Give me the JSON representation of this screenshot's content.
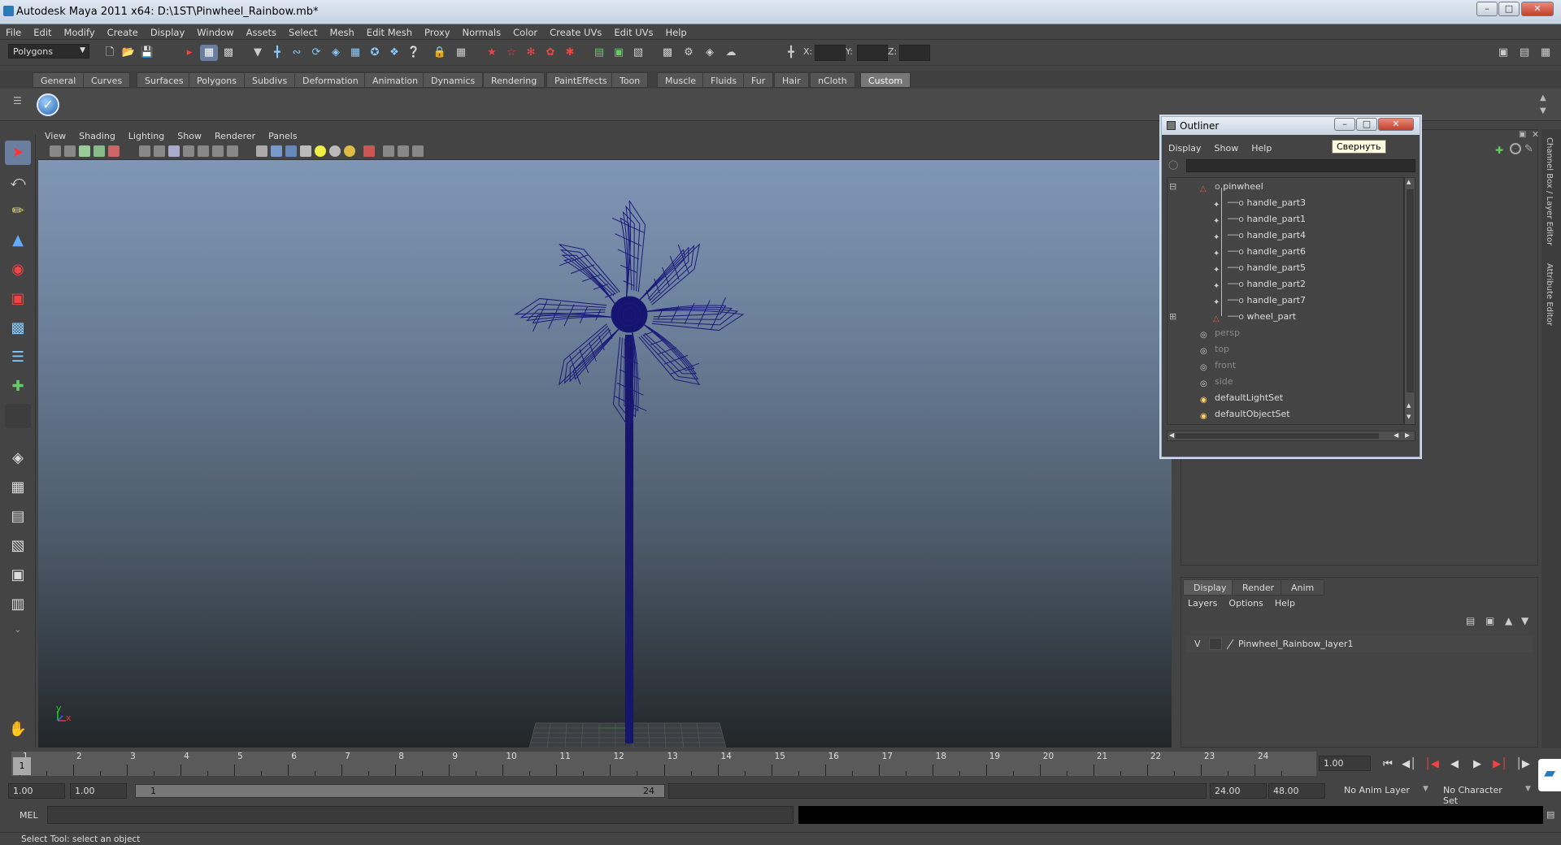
{
  "window": {
    "title": "Autodesk Maya 2011 x64: D:\\1ST\\Pinwheel_Rainbow.mb*"
  },
  "menubar": [
    "File",
    "Edit",
    "Modify",
    "Create",
    "Display",
    "Window",
    "Assets",
    "Select",
    "Mesh",
    "Edit Mesh",
    "Proxy",
    "Normals",
    "Color",
    "Create UVs",
    "Edit UVs",
    "Help"
  ],
  "statusline": {
    "mode": "Polygons",
    "x_label": "X:",
    "y_label": "Y:",
    "z_label": "Z:"
  },
  "shelf": {
    "tabs": [
      "General",
      "Curves",
      "Surfaces",
      "Polygons",
      "Subdivs",
      "Deformation",
      "Animation",
      "Dynamics",
      "Rendering",
      "PaintEffects",
      "Toon",
      "Muscle",
      "Fluids",
      "Fur",
      "Hair",
      "nCloth",
      "Custom"
    ],
    "active": "Custom"
  },
  "viewport": {
    "menus": [
      "View",
      "Shading",
      "Lighting",
      "Show",
      "Renderer",
      "Panels"
    ],
    "axis_y": "y",
    "axis_x": "x",
    "wire_color": "#1a1a7a"
  },
  "outliner": {
    "title": "Outliner",
    "menus": [
      "Display",
      "Show",
      "Help"
    ],
    "tooltip": "Свернуть",
    "items": [
      {
        "label": "pinwheel",
        "level": 0,
        "dim": false,
        "kind": "transform"
      },
      {
        "label": "handle_part3",
        "level": 1,
        "dim": false,
        "kind": "mesh"
      },
      {
        "label": "handle_part1",
        "level": 1,
        "dim": false,
        "kind": "mesh"
      },
      {
        "label": "handle_part4",
        "level": 1,
        "dim": false,
        "kind": "mesh"
      },
      {
        "label": "handle_part6",
        "level": 1,
        "dim": false,
        "kind": "mesh"
      },
      {
        "label": "handle_part5",
        "level": 1,
        "dim": false,
        "kind": "mesh"
      },
      {
        "label": "handle_part2",
        "level": 1,
        "dim": false,
        "kind": "mesh"
      },
      {
        "label": "handle_part7",
        "level": 1,
        "dim": false,
        "kind": "mesh"
      },
      {
        "label": "wheel_part",
        "level": 1,
        "dim": false,
        "kind": "transform"
      },
      {
        "label": "persp",
        "level": 0,
        "dim": true,
        "kind": "camera"
      },
      {
        "label": "top",
        "level": 0,
        "dim": true,
        "kind": "camera"
      },
      {
        "label": "front",
        "level": 0,
        "dim": true,
        "kind": "camera"
      },
      {
        "label": "side",
        "level": 0,
        "dim": true,
        "kind": "camera"
      },
      {
        "label": "defaultLightSet",
        "level": 0,
        "dim": false,
        "kind": "set"
      },
      {
        "label": "defaultObjectSet",
        "level": 0,
        "dim": false,
        "kind": "set"
      }
    ]
  },
  "sidebar_tabs": [
    "Channel Box / Layer Editor",
    "Attribute Editor"
  ],
  "layer_editor": {
    "tabs": [
      "Display",
      "Render",
      "Anim"
    ],
    "active_tab": "Display",
    "menus": [
      "Layers",
      "Options",
      "Help"
    ],
    "layer": {
      "visible": "V",
      "name": "Pinwheel_Rainbow_layer1"
    }
  },
  "timeline": {
    "ticks": [
      "1",
      "2",
      "3",
      "4",
      "5",
      "6",
      "7",
      "8",
      "9",
      "10",
      "11",
      "12",
      "13",
      "14",
      "15",
      "16",
      "17",
      "18",
      "19",
      "20",
      "21",
      "22",
      "23",
      "24"
    ],
    "current_frame": "1",
    "current_time_field": "1.00",
    "start_time": "1.00",
    "playback_start": "1.00",
    "range_start_label": "1",
    "range_end_label": "24",
    "playback_end": "24.00",
    "end_time": "48.00",
    "anim_layer": "No Anim Layer",
    "character_set": "No Character Set"
  },
  "cmdline": {
    "label": "MEL"
  },
  "helpline": "Select Tool: select an object"
}
